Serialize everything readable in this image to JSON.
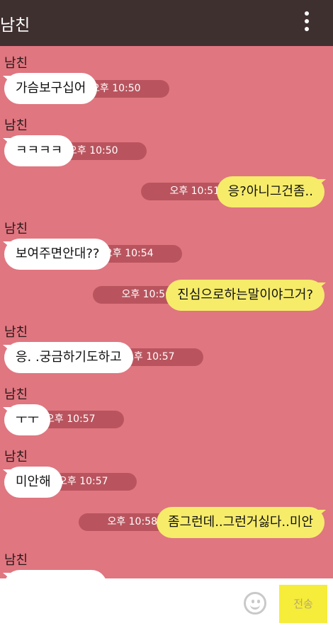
{
  "header": {
    "title": "남친",
    "menu_icon": "more-vertical-icon"
  },
  "messages": [
    {
      "sender": "남친",
      "text": "가슴보구십어",
      "time": "오후 10:50"
    },
    {
      "sender": "남친",
      "text": "ㅋㅋㅋㅋ",
      "time": "오후 10:50"
    },
    {
      "text": "응?아니그건좀..",
      "time": "오후 10:51"
    },
    {
      "sender": "남친",
      "text": "보여주면안대??",
      "time": "오후 10:54"
    },
    {
      "text": "진심으로하는말이야그거?",
      "time": "오후 10:56"
    },
    {
      "sender": "남친",
      "text": "응. .궁금하기도하고",
      "time": "오후 10:57"
    },
    {
      "sender": "남친",
      "text": "ㅜㅜ",
      "time": "오후 10:57"
    },
    {
      "sender": "남친",
      "text": "미안해",
      "time": "오후 10:57"
    },
    {
      "text": "좀그런데..그런거싫다..미안",
      "time": "오후 10:58"
    },
    {
      "sender": "남친"
    }
  ],
  "input": {
    "placeholder": "",
    "emoji_icon": "smiley-icon",
    "send_label": "전송"
  },
  "colors": {
    "background": "#e07680",
    "header": "#3f3030",
    "incoming": "#ffffff",
    "outgoing": "#f6ec6a",
    "time_pill": "#b9545e",
    "send_button": "#f6ec3a"
  }
}
